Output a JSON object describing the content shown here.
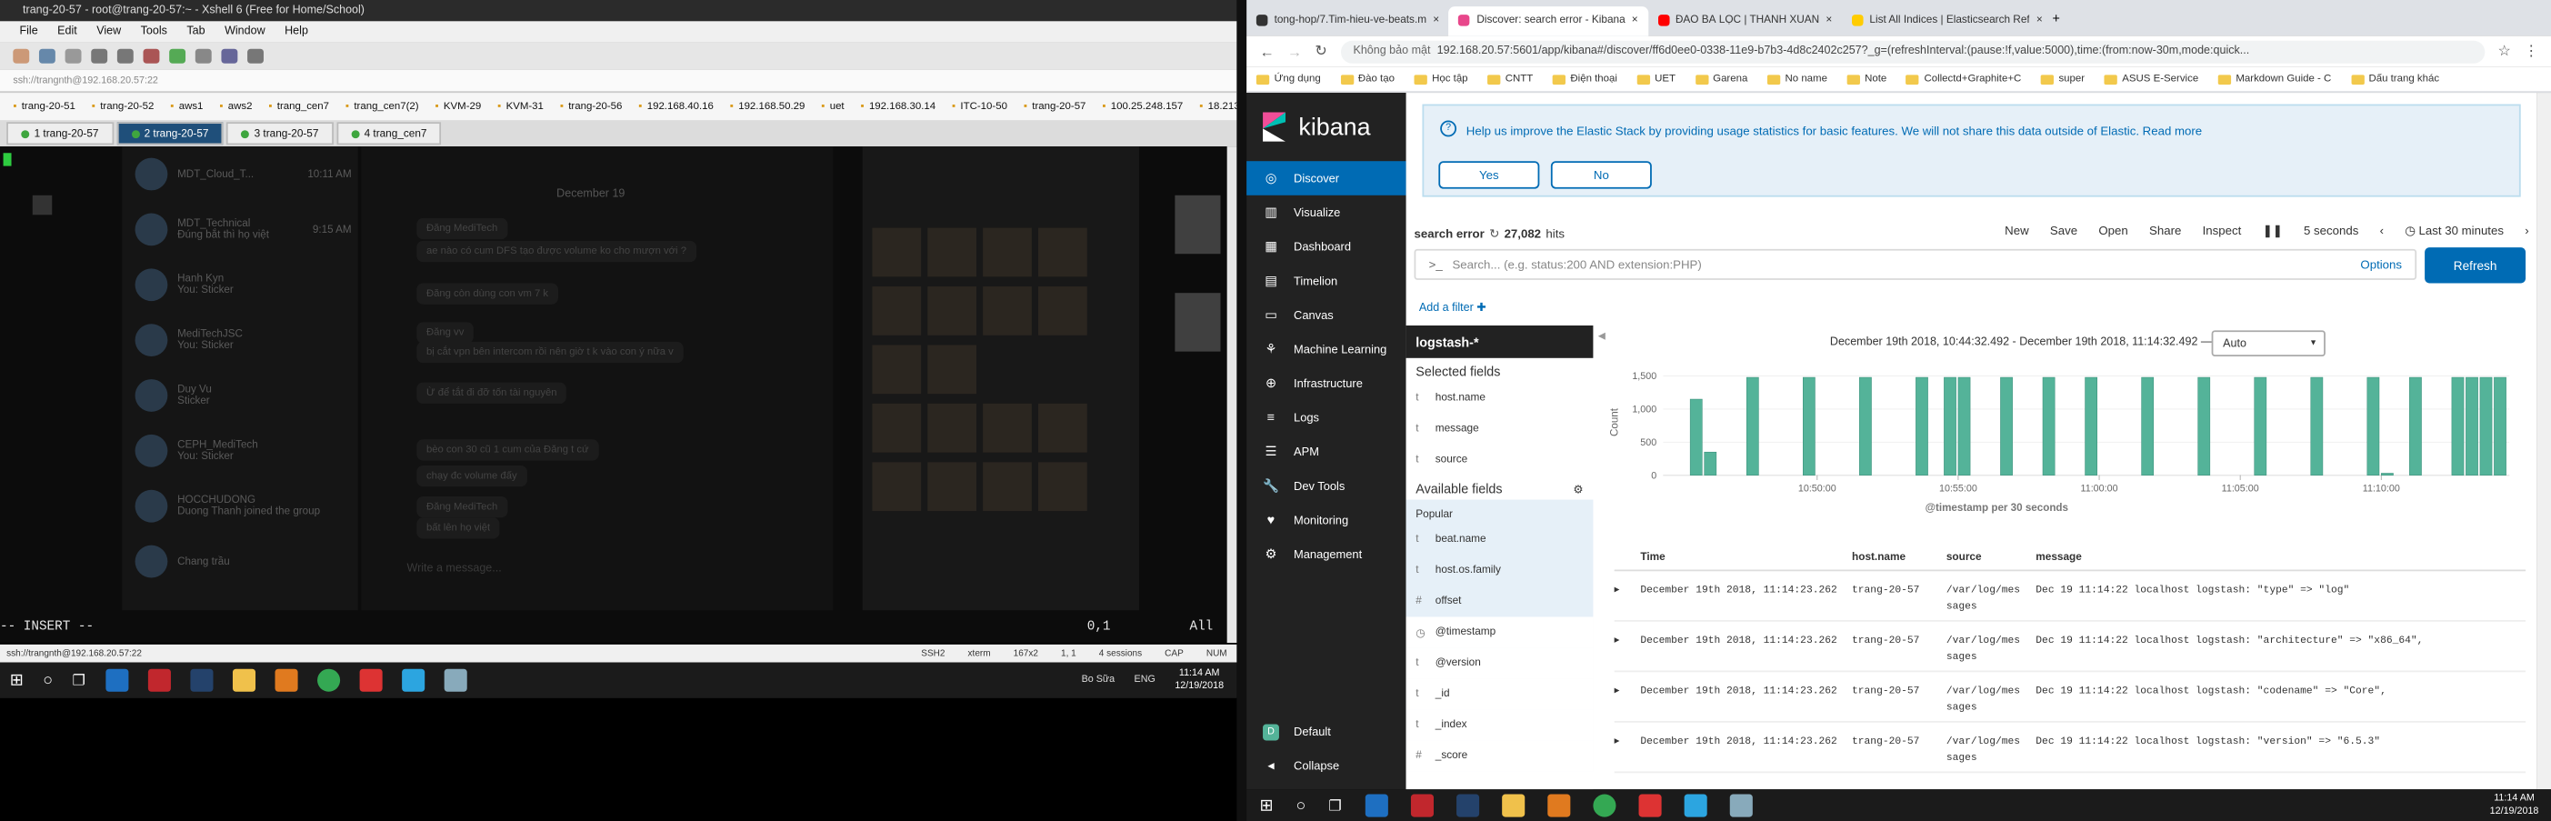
{
  "xshell": {
    "title": "trang-20-57 - root@trang-20-57:~ - Xshell 6 (Free for Home/School)",
    "menu": [
      "File",
      "Edit",
      "View",
      "Tools",
      "Tab",
      "Window",
      "Help"
    ],
    "address": "ssh://trangnth@192.168.20.57:22",
    "sessions": [
      "trang-20-51",
      "trang-20-52",
      "aws1",
      "aws2",
      "trang_cen7",
      "trang_cen7(2)",
      "KVM-29",
      "KVM-31",
      "trang-20-56",
      "192.168.40.16",
      "192.168.50.29",
      "uet",
      "192.168.30.14",
      "ITC-10-50",
      "trang-20-57",
      "100.25.248.157",
      "18.213.118.81"
    ],
    "tabs": [
      "1 trang-20-57",
      "2 trang-20-57",
      "3 trang-20-57",
      "4 trang_cen7"
    ],
    "overlay_title": "MDT_Technical",
    "insert_mode": "-- INSERT --",
    "cursor_pos": "0,1",
    "scroll_pos": "All",
    "status": {
      "connection": "ssh://trangnth@192.168.20.57:22",
      "protocol": "SSH2",
      "term": "xterm",
      "size": "167x2",
      "pos": "1, 1",
      "sessions": "4 sessions",
      "caps": "CAP",
      "num": "NUM"
    },
    "chats": [
      {
        "name": "MDT_Cloud_T...",
        "time": "10:11 AM"
      },
      {
        "name": "MDT_Technical",
        "time": "9:15 AM",
        "preview": "Đúng bắt thì họ việt"
      },
      {
        "name": "Hanh Kyn",
        "time": "",
        "preview": "You: Sticker"
      },
      {
        "name": "MediTechJSC",
        "time": "",
        "preview": "You: Sticker"
      },
      {
        "name": "Duy Vu",
        "time": "",
        "preview": "Sticker"
      },
      {
        "name": "CEPH_MediTech",
        "time": "",
        "preview": "You: Sticker"
      },
      {
        "name": "HOCCHUDONG",
        "time": "",
        "preview": "Duong Thanh joined the group"
      },
      {
        "name": "Chang trầu",
        "time": ""
      }
    ],
    "date_divider": "December 19",
    "messages": [
      "Đăng MediTech",
      "ae nào có cum DFS tạo được volume ko cho mượn với ?",
      "Đăng còn dùng con vm 7 k",
      "Đăng vv",
      "bị cắt vpn bên intercom rồi nên giờ t k vào con ý nữa v",
      "Ừ để tắt đi đỡ tốn tài nguyên",
      "bèo con 30 cũ 1 cum của Đăng t cứ",
      "chạy đc volume đấy",
      "Đăng MediTech",
      "bất lên họ việt"
    ],
    "search_placeholder": "Write a message..."
  },
  "taskbar_left": {
    "time": "11:14 AM",
    "date": "12/19/2018",
    "lang": "ENG",
    "user": "Bo Sữa"
  },
  "browser": {
    "tabs": [
      "tong-hop/7.Tim-hieu-ve-beats.m",
      "Discover: search error - Kibana",
      "ĐÀO BÁ LỘC | THANH XUÂN",
      "List All Indices | Elasticsearch Ref"
    ],
    "security": "Không bảo mật",
    "url": "192.168.20.57:5601/app/kibana#/discover/ff6d0ee0-0338-11e9-b7b3-4d8c2402c257?_g=(refreshInterval:(pause:!f,value:5000),time:(from:now-30m,mode:quick...",
    "bookmarks": [
      "Ứng dụng",
      "Đào tạo",
      "Học tập",
      "CNTT",
      "Điện thoại",
      "UET",
      "Garena",
      "No name",
      "Note",
      "Collectd+Graphite+C",
      "super",
      "ASUS E-Service",
      "Markdown Guide - C",
      "Dấu trang khác"
    ]
  },
  "kibana": {
    "logo": "kibana",
    "nav": [
      "Discover",
      "Visualize",
      "Dashboard",
      "Timelion",
      "Canvas",
      "Machine Learning",
      "Infrastructure",
      "Logs",
      "APM",
      "Dev Tools",
      "Monitoring",
      "Management"
    ],
    "bottom_nav": [
      "Default",
      "Collapse"
    ],
    "banner_text": "Help us improve the Elastic Stack by providing usage statistics for basic features. We will not share this data outside of Elastic. Read more",
    "yes": "Yes",
    "no": "No",
    "saved_search": "search error",
    "hits": "27,082",
    "hits_label": "hits",
    "menu": [
      "New",
      "Save",
      "Open",
      "Share",
      "Inspect"
    ],
    "interval": "5 seconds",
    "timerange": "Last 30 minutes",
    "search_placeholder": "Search... (e.g. status:200 AND extension:PHP)",
    "options": "Options",
    "refresh": "Refresh",
    "add_filter": "Add a filter",
    "index": "logstash-*",
    "selected_fields_title": "Selected fields",
    "selected_fields": [
      {
        "t": "t",
        "n": "host.name"
      },
      {
        "t": "t",
        "n": "message"
      },
      {
        "t": "t",
        "n": "source"
      }
    ],
    "available_title": "Available fields",
    "popular": "Popular",
    "available_fields": [
      {
        "t": "t",
        "n": "beat.name"
      },
      {
        "t": "t",
        "n": "host.os.family"
      },
      {
        "t": "#",
        "n": "offset"
      },
      {
        "t": "◷",
        "n": "@timestamp"
      },
      {
        "t": "t",
        "n": "@version"
      },
      {
        "t": "t",
        "n": "_id"
      },
      {
        "t": "t",
        "n": "_index"
      },
      {
        "t": "#",
        "n": "_score"
      }
    ],
    "range_label": "December 19th 2018, 10:44:32.492 - December 19th 2018, 11:14:32.492 —",
    "auto": "Auto",
    "columns": [
      "Time",
      "host.name",
      "source",
      "message"
    ],
    "rows": [
      {
        "time": "December 19th 2018, 11:14:23.262",
        "host": "trang-20-57",
        "source1": "/var/log/mes",
        "source2": "sages",
        "msg": "Dec 19 11:14:22 localhost logstash: \"type\" => \"log\""
      },
      {
        "time": "December 19th 2018, 11:14:23.262",
        "host": "trang-20-57",
        "source1": "/var/log/mes",
        "source2": "sages",
        "msg": "Dec 19 11:14:22 localhost logstash: \"architecture\" => \"x86_64\","
      },
      {
        "time": "December 19th 2018, 11:14:23.262",
        "host": "trang-20-57",
        "source1": "/var/log/mes",
        "source2": "sages",
        "msg": "Dec 19 11:14:22 localhost logstash: \"codename\" => \"Core\","
      },
      {
        "time": "December 19th 2018, 11:14:23.262",
        "host": "trang-20-57",
        "source1": "/var/log/mes",
        "source2": "sages",
        "msg": "Dec 19 11:14:22 localhost logstash: \"version\" => \"6.5.3\""
      }
    ]
  },
  "chart_data": {
    "type": "bar",
    "ylabel": "Count",
    "xlabel": "@timestamp per 30 seconds",
    "yticks": [
      0,
      500,
      1000,
      1500
    ],
    "ylim": [
      0,
      1600
    ],
    "xticks": [
      "10:50:00",
      "10:55:00",
      "11:00:00",
      "11:05:00",
      "11:10:00"
    ],
    "x": [
      "10:45:30",
      "10:46:00",
      "10:47:30",
      "10:49:30",
      "10:51:30",
      "10:53:30",
      "10:54:30",
      "10:55:00",
      "10:56:30",
      "10:58:00",
      "10:59:30",
      "11:01:30",
      "11:03:30",
      "11:05:30",
      "11:07:30",
      "11:09:30",
      "11:10:00",
      "11:11:00",
      "11:12:30",
      "11:13:00",
      "11:13:30",
      "11:14:00"
    ],
    "values": [
      1150,
      350,
      1480,
      1480,
      1480,
      1480,
      1480,
      1480,
      1480,
      1480,
      1480,
      1480,
      1480,
      1480,
      1480,
      1480,
      30,
      1480,
      1480,
      1480,
      1480,
      1480
    ],
    "color": "#54b399"
  },
  "taskbar_right": {
    "time": "11:14 AM",
    "date": "12/19/2018"
  }
}
